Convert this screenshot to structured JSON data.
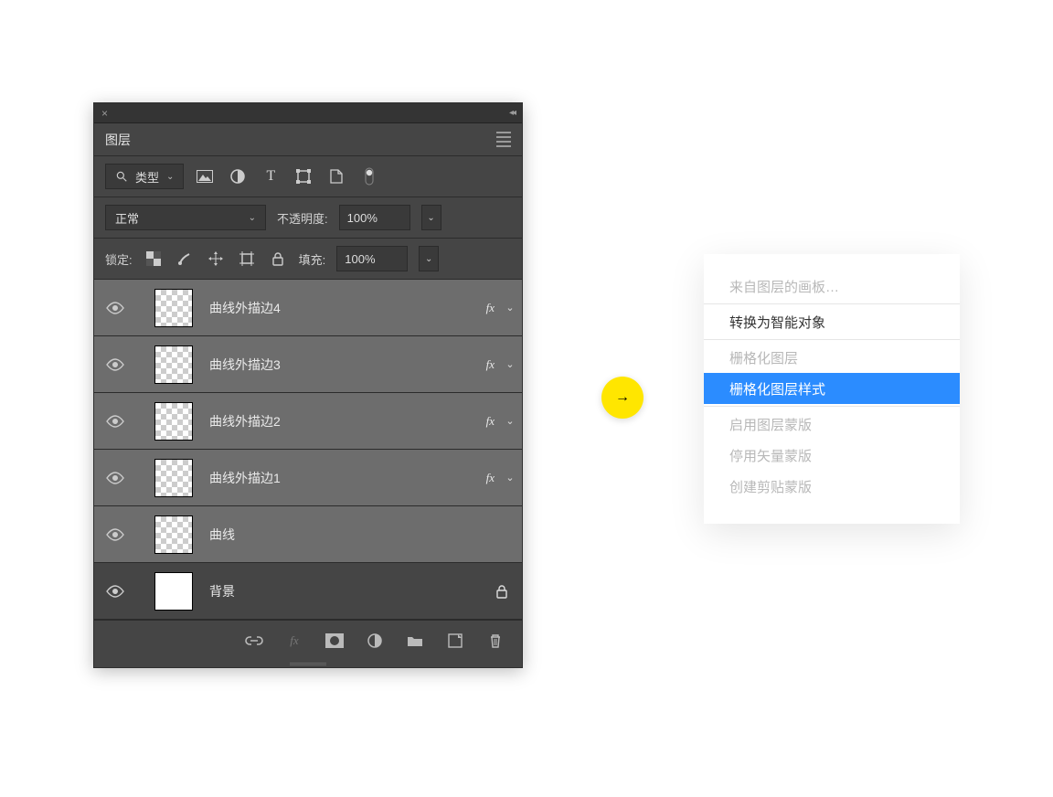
{
  "panel": {
    "title": "图层",
    "filter": {
      "kind_label": "类型",
      "icons": [
        "image-icon",
        "adjust-icon",
        "text-icon",
        "shape-icon",
        "smart-icon",
        "dot-icon"
      ]
    },
    "blend": {
      "mode": "正常",
      "opacity_label": "不透明度:",
      "opacity_value": "100%"
    },
    "lock": {
      "label": "锁定:",
      "fill_label": "填充:",
      "fill_value": "100%"
    },
    "layers": [
      {
        "name": "曲线外描边4",
        "fx": "fx",
        "checker": true,
        "selected": true,
        "locked": false
      },
      {
        "name": "曲线外描边3",
        "fx": "fx",
        "checker": true,
        "selected": true,
        "locked": false
      },
      {
        "name": "曲线外描边2",
        "fx": "fx",
        "checker": true,
        "selected": true,
        "locked": false
      },
      {
        "name": "曲线外描边1",
        "fx": "fx",
        "checker": true,
        "selected": true,
        "locked": false
      },
      {
        "name": "曲线",
        "fx": "",
        "checker": true,
        "selected": true,
        "locked": false
      },
      {
        "name": "背景",
        "fx": "",
        "checker": false,
        "selected": false,
        "locked": true
      }
    ]
  },
  "arrow": "→",
  "context_menu": {
    "items": [
      {
        "label": "来自图层的画板…",
        "state": "disabled"
      },
      {
        "type": "sep"
      },
      {
        "label": "转换为智能对象",
        "state": "normal"
      },
      {
        "type": "sep"
      },
      {
        "label": "栅格化图层",
        "state": "disabled"
      },
      {
        "label": "栅格化图层样式",
        "state": "hover"
      },
      {
        "type": "sep"
      },
      {
        "label": "启用图层蒙版",
        "state": "disabled"
      },
      {
        "label": "停用矢量蒙版",
        "state": "disabled"
      },
      {
        "label": "创建剪贴蒙版",
        "state": "disabled"
      }
    ]
  }
}
